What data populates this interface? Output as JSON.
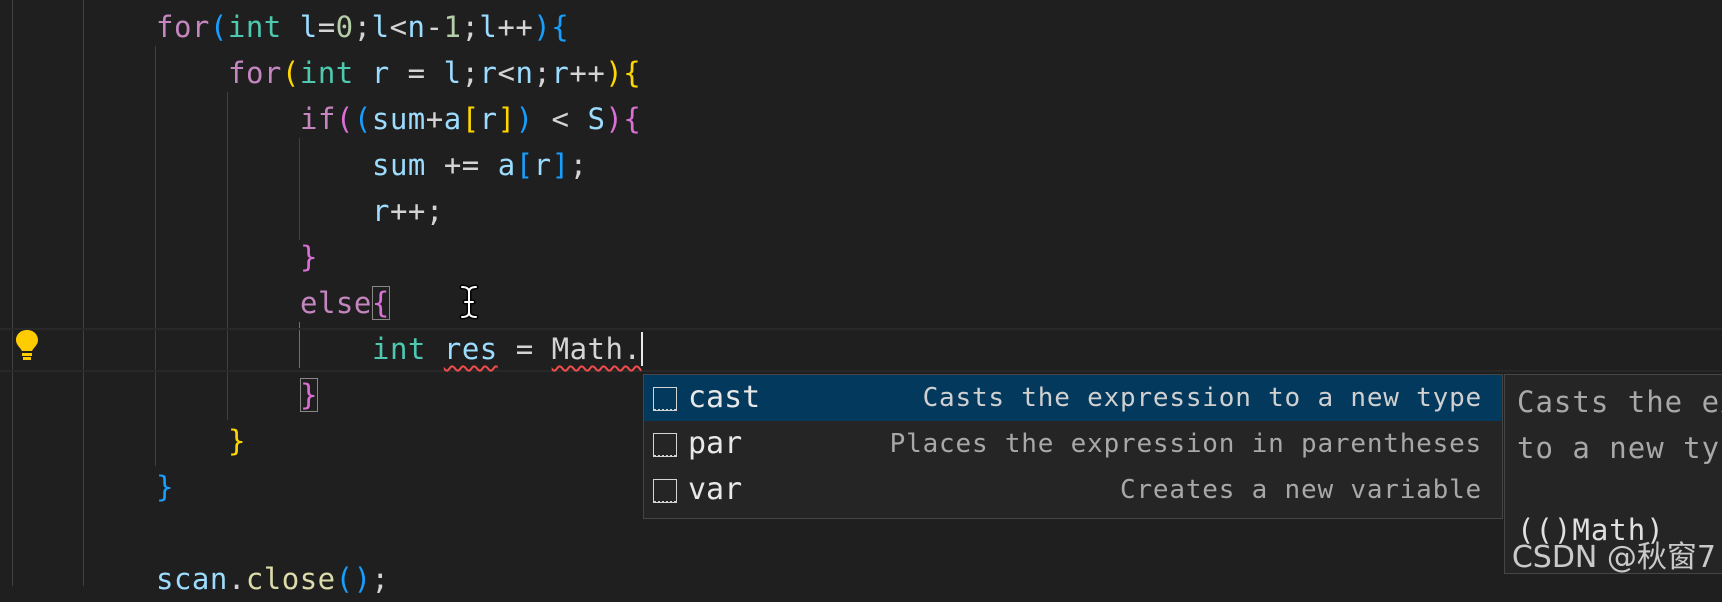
{
  "editor": {
    "lines": [
      {
        "tokens": [
          {
            "t": "for",
            "c": "kw"
          },
          {
            "t": "(",
            "c": "p3"
          },
          {
            "t": "int",
            "c": "ty"
          },
          {
            "t": " "
          },
          {
            "t": "l",
            "c": "var"
          },
          {
            "t": "="
          },
          {
            "t": "0",
            "c": "num"
          },
          {
            "t": ";"
          },
          {
            "t": "l",
            "c": "var"
          },
          {
            "t": "<"
          },
          {
            "t": "n",
            "c": "var"
          },
          {
            "t": "-"
          },
          {
            "t": "1",
            "c": "num"
          },
          {
            "t": ";"
          },
          {
            "t": "l",
            "c": "var"
          },
          {
            "t": "++"
          },
          {
            "t": ")",
            "c": "p3"
          },
          {
            "t": "{",
            "c": "p3"
          }
        ]
      },
      {
        "tokens": [
          {
            "t": "for",
            "c": "kw"
          },
          {
            "t": "(",
            "c": "p1"
          },
          {
            "t": "int",
            "c": "ty"
          },
          {
            "t": " "
          },
          {
            "t": "r",
            "c": "var"
          },
          {
            "t": " = "
          },
          {
            "t": "l",
            "c": "var"
          },
          {
            "t": ";"
          },
          {
            "t": "r",
            "c": "var"
          },
          {
            "t": "<"
          },
          {
            "t": "n",
            "c": "var"
          },
          {
            "t": ";"
          },
          {
            "t": "r",
            "c": "var"
          },
          {
            "t": "++"
          },
          {
            "t": ")",
            "c": "p1"
          },
          {
            "t": "{",
            "c": "p1"
          }
        ]
      },
      {
        "tokens": [
          {
            "t": "if",
            "c": "kw"
          },
          {
            "t": "(",
            "c": "p2"
          },
          {
            "t": "(",
            "c": "p3"
          },
          {
            "t": "sum",
            "c": "var"
          },
          {
            "t": "+"
          },
          {
            "t": "a",
            "c": "var"
          },
          {
            "t": "[",
            "c": "p1"
          },
          {
            "t": "r",
            "c": "var"
          },
          {
            "t": "]",
            "c": "p1"
          },
          {
            "t": ")",
            "c": "p3"
          },
          {
            "t": " < "
          },
          {
            "t": "S",
            "c": "var"
          },
          {
            "t": ")",
            "c": "p2"
          },
          {
            "t": "{",
            "c": "p2"
          }
        ]
      },
      {
        "tokens": [
          {
            "t": "sum",
            "c": "var"
          },
          {
            "t": " += "
          },
          {
            "t": "a",
            "c": "var"
          },
          {
            "t": "[",
            "c": "p3"
          },
          {
            "t": "r",
            "c": "var"
          },
          {
            "t": "]",
            "c": "p3"
          },
          {
            "t": ";"
          }
        ]
      },
      {
        "tokens": [
          {
            "t": "r",
            "c": "var"
          },
          {
            "t": "++;"
          }
        ]
      },
      {
        "tokens": [
          {
            "t": "}",
            "c": "p2"
          }
        ]
      },
      {
        "tokens": [
          {
            "t": "else",
            "c": "kw"
          },
          {
            "t": "{",
            "c": "p2 bracket-box"
          }
        ]
      },
      {
        "tokens": [
          {
            "t": "int",
            "c": "ty"
          },
          {
            "t": " "
          },
          {
            "t": "res",
            "c": "var squig"
          },
          {
            "t": " = "
          },
          {
            "t": "Math.",
            "c": "squig"
          }
        ]
      },
      {
        "tokens": [
          {
            "t": "}",
            "c": "p2 bracket-box"
          }
        ]
      },
      {
        "tokens": [
          {
            "t": "}",
            "c": "p1"
          }
        ]
      },
      {
        "tokens": [
          {
            "t": "}",
            "c": "p3"
          }
        ]
      },
      {
        "tokens": []
      },
      {
        "tokens": [
          {
            "t": "scan",
            "c": "var"
          },
          {
            "t": "."
          },
          {
            "t": "close",
            "c": "fn"
          },
          {
            "t": "()",
            "c": "p3"
          },
          {
            "t": ";"
          }
        ]
      }
    ]
  },
  "suggestions": [
    {
      "label": "cast",
      "description": "Casts the expression to a new type",
      "selected": true
    },
    {
      "label": "par",
      "description": "Places the expression in parentheses",
      "selected": false
    },
    {
      "label": "var",
      "description": "Creates a new variable",
      "selected": false
    }
  ],
  "details": {
    "line1": "Casts the ex",
    "line2": "to a new typ",
    "signature": "(()Math)"
  },
  "watermark": "CSDN @秋窗7",
  "colors": {
    "background": "#1f1f1f",
    "selected_row": "#04395e",
    "lightbulb": "#ffcc00",
    "error_squiggle": "#f14c4c"
  },
  "icons": {
    "lightbulb": "lightbulb-icon",
    "cursor": "text-cursor-icon",
    "suggestion": "snippet-icon"
  }
}
